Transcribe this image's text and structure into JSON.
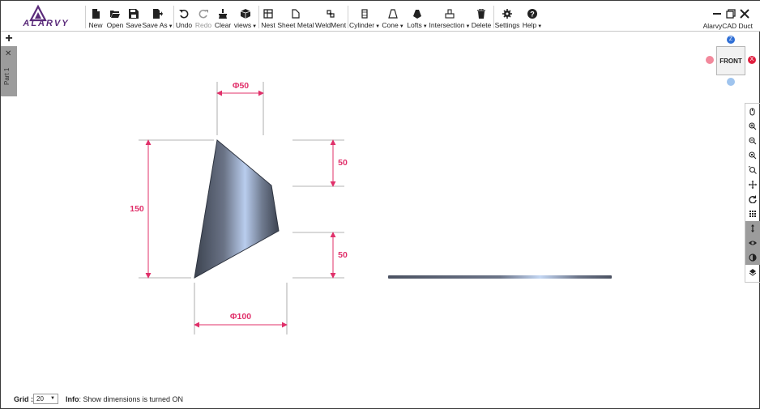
{
  "app": {
    "name": "AlarvyCAD Duct",
    "logo_text": "ALARVY"
  },
  "toolbar": {
    "new": "New",
    "open": "Open",
    "save": "Save",
    "save_as": "Save As",
    "undo": "Undo",
    "redo": "Redo",
    "clear": "Clear",
    "views": "views",
    "nest": "Nest",
    "sheet_metal": "Sheet Metal",
    "weldment": "WeldMent",
    "cylinder": "Cylinder",
    "cone": "Cone",
    "lofts": "Lofts",
    "intersection": "Intersection",
    "delete": "Delete",
    "settings": "Settings",
    "help": "Help"
  },
  "tabs": {
    "add": "+",
    "close": "✕",
    "part": "Part 1"
  },
  "viewcube": {
    "face": "FRONT",
    "z": "Z",
    "x": "X"
  },
  "dimensions": {
    "top_dia": "Φ50",
    "bottom_dia": "Φ100",
    "height": "150",
    "right_top": "50",
    "right_bottom": "50"
  },
  "status": {
    "grid_label": "Grid :",
    "grid_value": "20",
    "info_label": "Info",
    "info_text": ": Show dimensions is turned ON"
  },
  "colors": {
    "dimension": "#e0306a",
    "part_tab": "#9c9c9c",
    "z_axis": "#2f6fd6",
    "x_axis": "#e02040"
  },
  "icons": [
    "new-icon",
    "open-icon",
    "save-icon",
    "save-as-icon",
    "undo-icon",
    "redo-icon",
    "clear-icon",
    "views-icon",
    "nest-icon",
    "sheet-metal-icon",
    "weldment-icon",
    "cylinder-icon",
    "cone-icon",
    "lofts-icon",
    "intersection-icon",
    "delete-icon",
    "settings-icon",
    "help-icon"
  ]
}
